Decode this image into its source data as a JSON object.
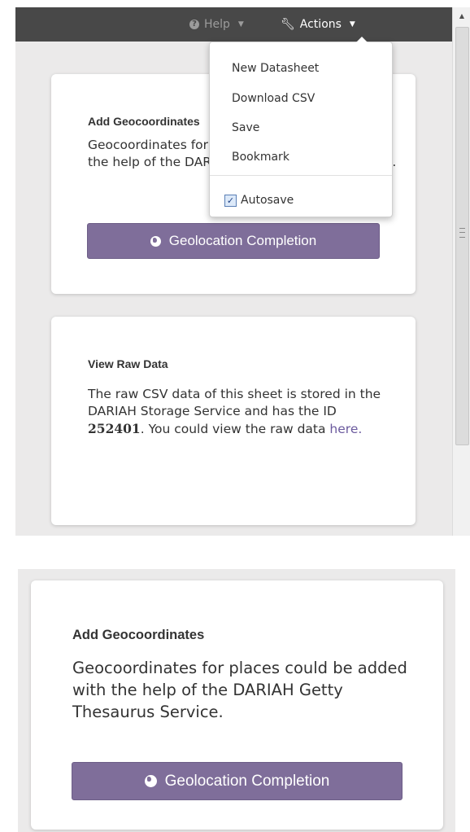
{
  "navbar": {
    "help_label": "Help",
    "actions_label": "Actions"
  },
  "dropdown": {
    "items": [
      "New Datasheet",
      "Download CSV",
      "Save",
      "Bookmark"
    ],
    "autosave_label": "Autosave",
    "autosave_checked": true
  },
  "card_geo": {
    "title": "Add Geocoordinates",
    "text": "Geocoordinates for places could be added with the help of the DARIAH Getty Thesaurus Service.",
    "button_label": "Geolocation Completion"
  },
  "card_raw": {
    "title": "View Raw Data",
    "text_before_id": "The raw CSV data of this sheet is stored in the DARIAH Storage Service and has the ID ",
    "id": "252401",
    "text_after_id": ". You could view the raw data ",
    "link_text": "here."
  },
  "colors": {
    "navbar_bg": "#484848",
    "button_bg": "#7f6e9a",
    "link": "#6b5a9e",
    "page_bg": "#ebeaea"
  }
}
